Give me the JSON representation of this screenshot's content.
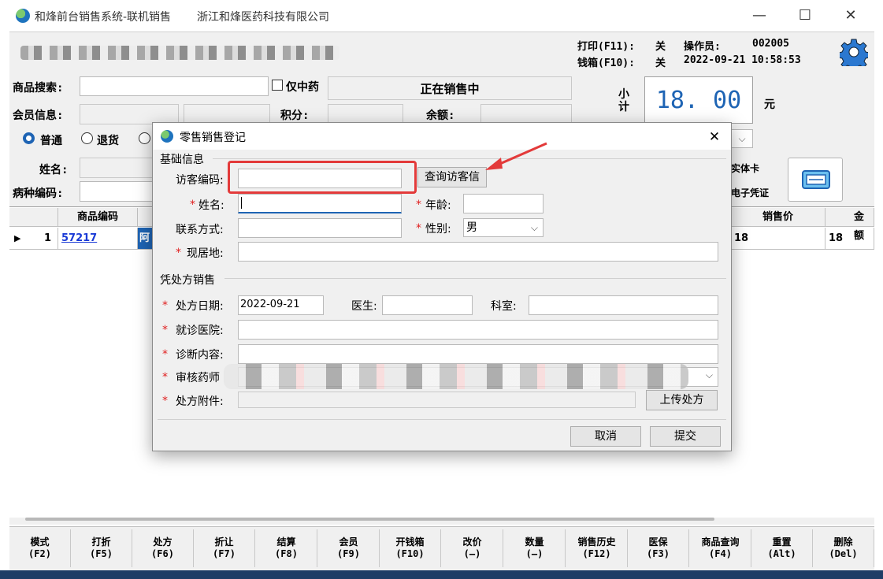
{
  "window": {
    "title": "和烽前台销售系统-联机销售",
    "company": "浙江和烽医药科技有限公司",
    "minimize": "—",
    "maximize": "☐",
    "close": "✕"
  },
  "status": {
    "print_label": "打印(F11):",
    "print_value": "关",
    "drawer_label": "钱箱(F10):",
    "drawer_value": "关",
    "operator_label": "操作员:",
    "operator_value": "002005",
    "datetime": "2022-09-21 10:58:53"
  },
  "main": {
    "search_label": "商品搜索:",
    "search_value": "",
    "tcm_only_label": "仅中药",
    "selling_status": "正在销售中",
    "subtotal_label": "小计",
    "subtotal_value": "18. 00",
    "currency": "元",
    "member_label": "会员信息:",
    "points_label": "积分:",
    "balance_label": "余额:",
    "mode_normal": "普通",
    "mode_return": "退货",
    "name_label": "姓名:",
    "disease_code_label": "病种编码:",
    "physical_card": "实体卡",
    "e_voucher": "电子凭证"
  },
  "grid": {
    "headers": [
      "商品编码",
      "销售价",
      "金额"
    ],
    "rows": [
      {
        "index": "1",
        "code": "57217",
        "name_fragment": "阿",
        "price": "18",
        "amount": "18"
      }
    ]
  },
  "fkeys": [
    {
      "label": "模式",
      "key": "(F2)"
    },
    {
      "label": "打折",
      "key": "(F5)"
    },
    {
      "label": "处方",
      "key": "(F6)"
    },
    {
      "label": "折让",
      "key": "(F7)"
    },
    {
      "label": "结算",
      "key": "(F8)"
    },
    {
      "label": "会员",
      "key": "(F9)"
    },
    {
      "label": "开钱箱",
      "key": "(F10)"
    },
    {
      "label": "改价",
      "key": "(—)"
    },
    {
      "label": "数量",
      "key": "(—)"
    },
    {
      "label": "销售历史",
      "key": "(F12)"
    },
    {
      "label": "医保",
      "key": "(F3)"
    },
    {
      "label": "商品查询",
      "key": "(F4)"
    },
    {
      "label": "重置",
      "key": "(Alt)"
    },
    {
      "label": "删除",
      "key": "(Del)"
    }
  ],
  "dialog": {
    "title": "零售销售登记",
    "close": "✕",
    "basic_section": "基础信息",
    "visitor_code_label": "访客编码:",
    "visitor_code_value": "",
    "query_visitor_button": "查询访客信",
    "name_label": "姓名:",
    "name_value": "",
    "age_label": "年龄:",
    "age_value": "",
    "contact_label": "联系方式:",
    "contact_value": "",
    "gender_label": "性别:",
    "gender_value": "男",
    "address_label": "现居地:",
    "address_value": "",
    "rx_section": "凭处方销售",
    "rx_date_label": "处方日期:",
    "rx_date_value": "2022-09-21",
    "doctor_label": "医生:",
    "doctor_value": "",
    "department_label": "科室:",
    "department_value": "",
    "hospital_label": "就诊医院:",
    "hospital_value": "",
    "diagnosis_label": "诊断内容:",
    "diagnosis_value": "",
    "pharmacist_label": "审核药师",
    "attachment_label": "处方附件:",
    "upload_button": "上传处方",
    "cancel_button": "取消",
    "submit_button": "提交",
    "required_mark": "*"
  }
}
